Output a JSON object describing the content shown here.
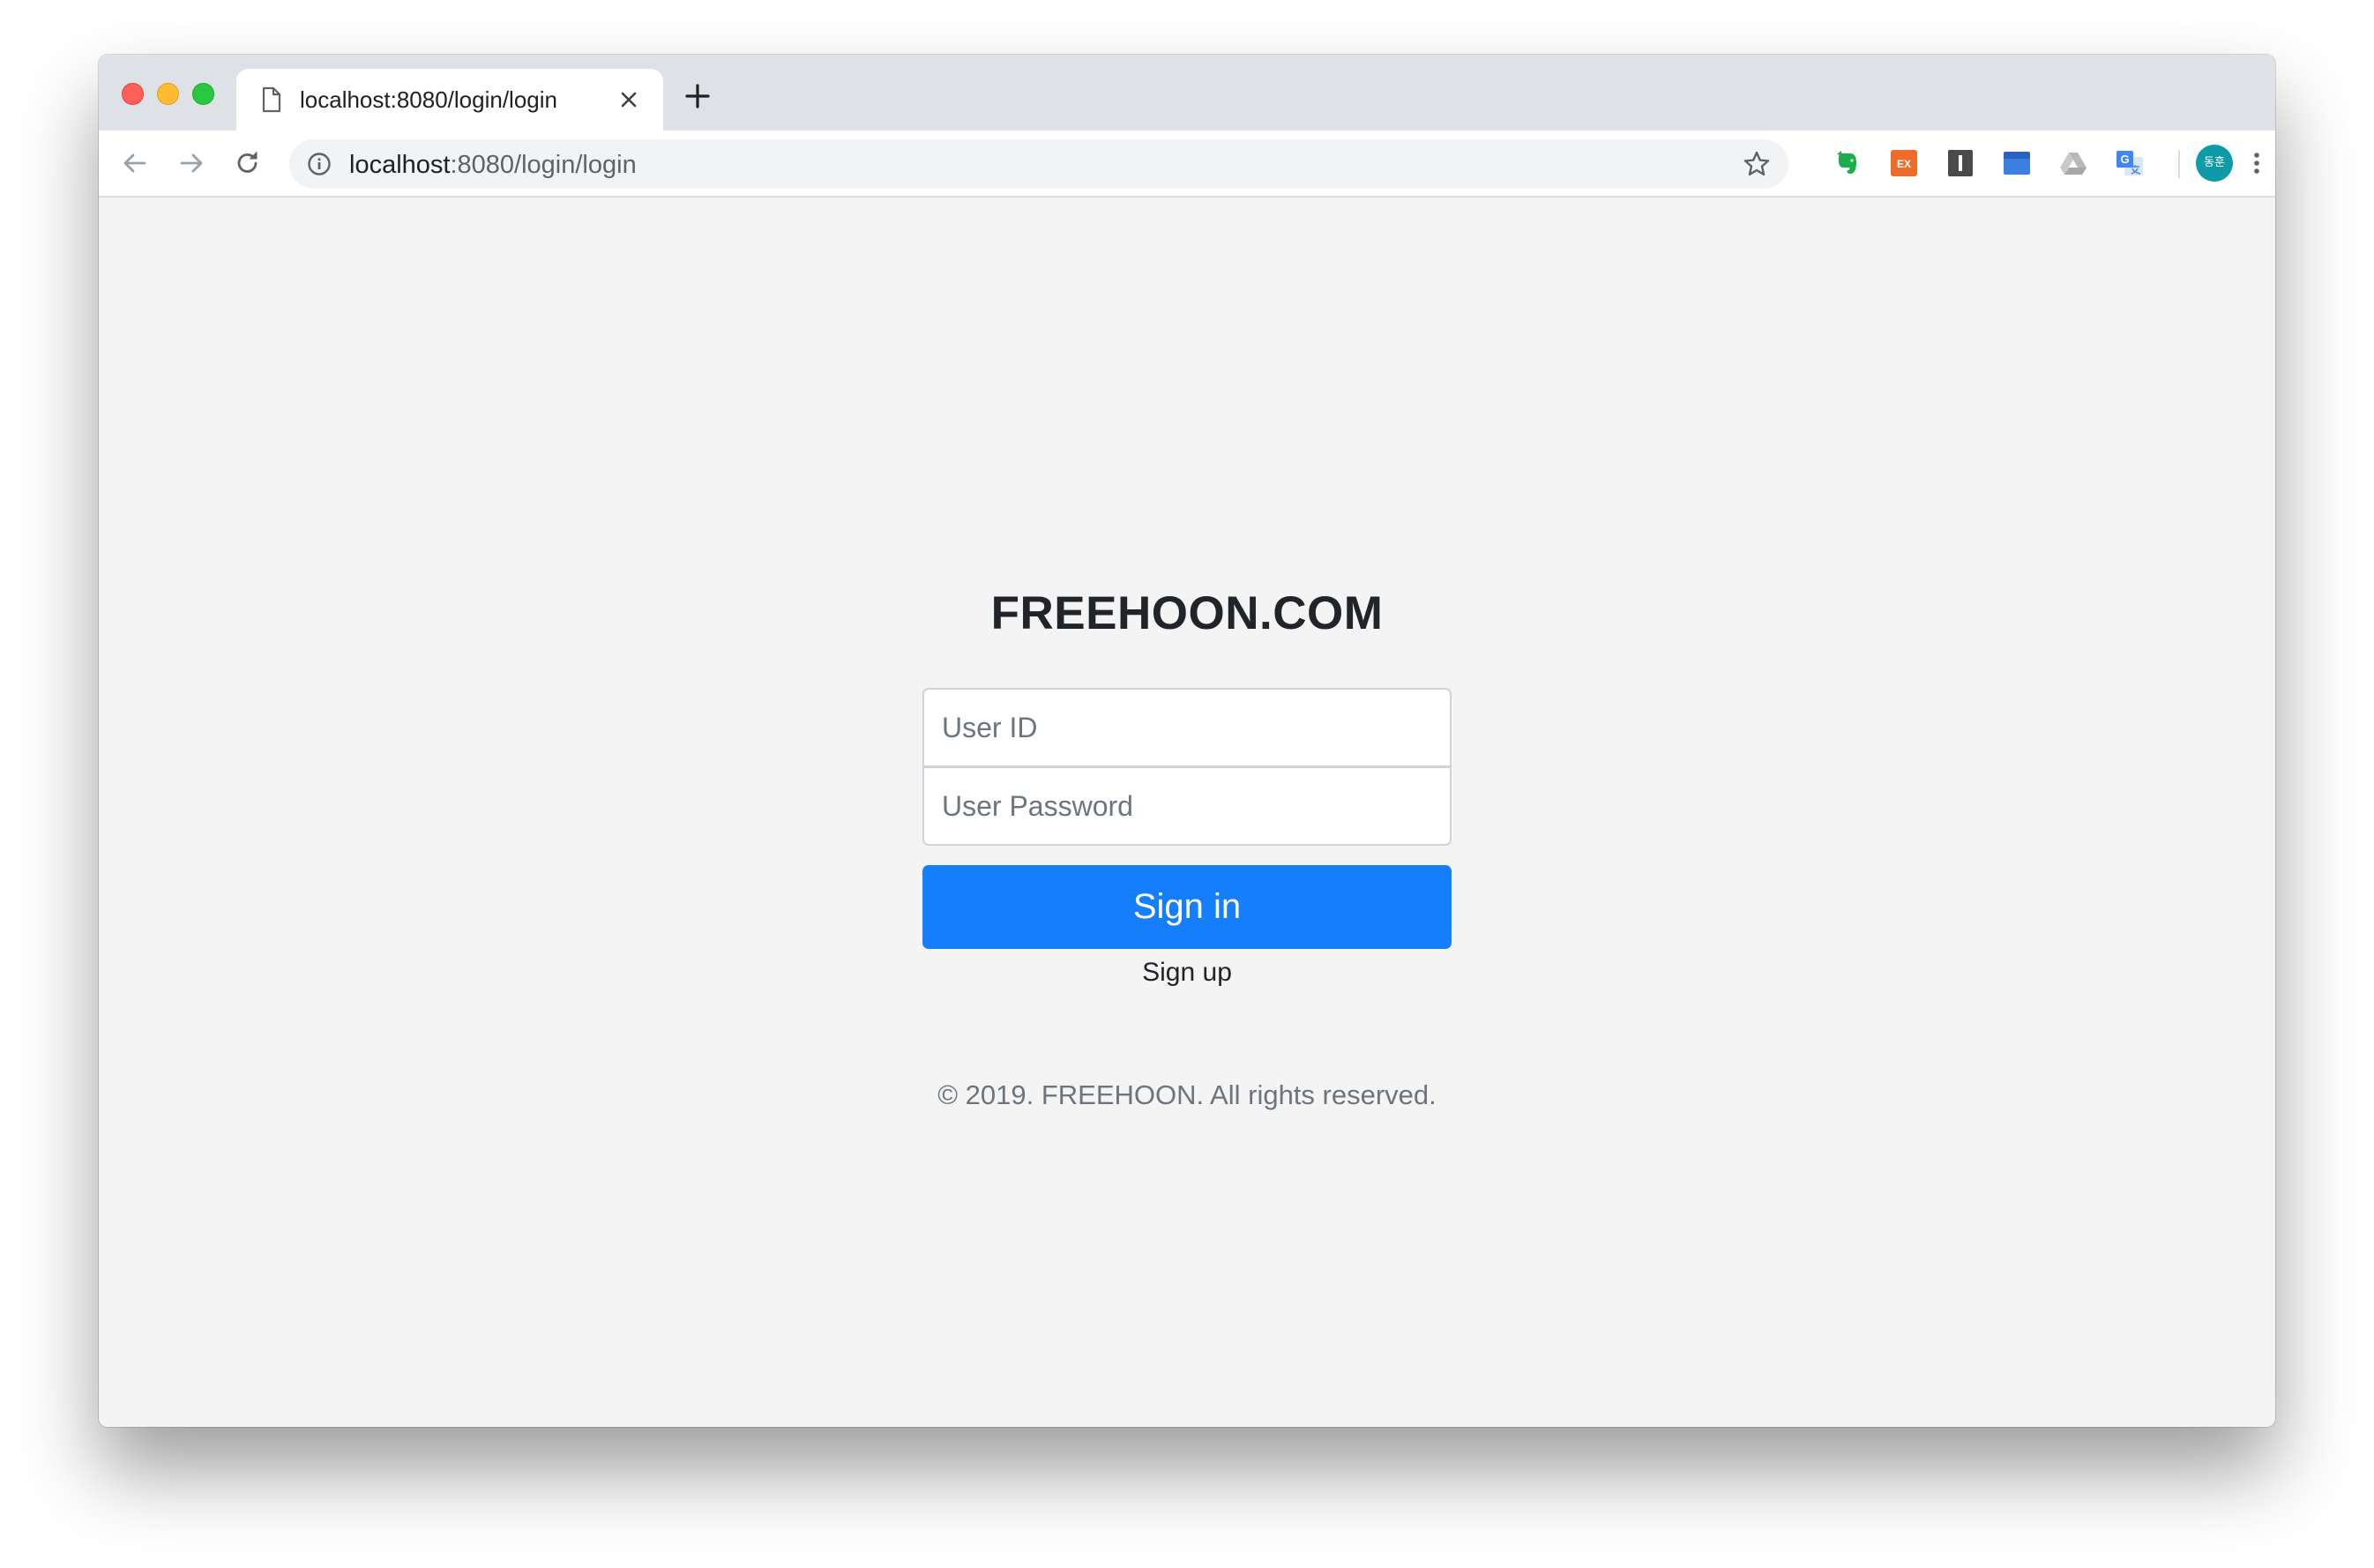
{
  "browser": {
    "tab": {
      "title": "localhost:8080/login/login"
    },
    "address_bar": {
      "host": "localhost",
      "path": ":8080/login/login"
    },
    "extensions": [
      "evernote-icon",
      "ex-extension-icon",
      "instapaper-icon",
      "box-icon",
      "google-drive-icon",
      "google-translate-icon"
    ],
    "profile": {
      "initials": "동훈"
    }
  },
  "page": {
    "brand": "FREEHOON.COM",
    "login_form": {
      "user_id_placeholder": "User ID",
      "password_placeholder": "User Password",
      "signin_label": "Sign in",
      "signup_label": "Sign up"
    },
    "footer": "© 2019. FREEHOON. All rights reserved."
  },
  "colors": {
    "primary_button": "#147efb",
    "page_background": "#f4f4f4",
    "tabstrip_background": "#dee1e6"
  }
}
